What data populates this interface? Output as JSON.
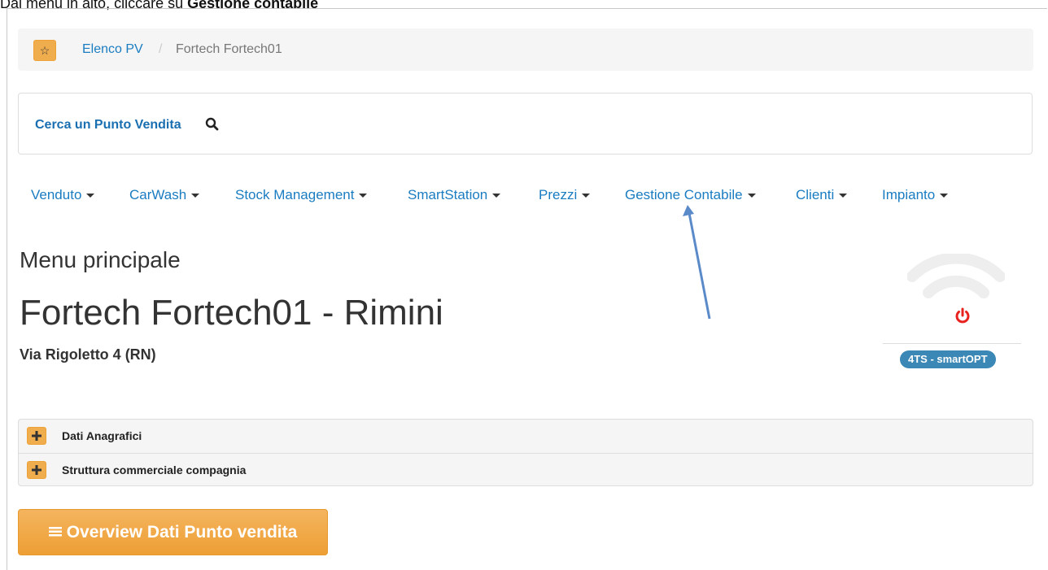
{
  "caption": {
    "prefix": "Dal menu in alto, cliccare su ",
    "bold": "Gestione contabile"
  },
  "breadcrumb": {
    "star_icon": "star-icon",
    "link": "Elenco PV",
    "separator": "/",
    "current": "Fortech Fortech01"
  },
  "search": {
    "label": "Cerca un Punto Vendita",
    "icon": "search-icon"
  },
  "nav": {
    "items": [
      {
        "label": "Venduto"
      },
      {
        "label": "CarWash"
      },
      {
        "label": "Stock Management"
      },
      {
        "label": "SmartStation"
      },
      {
        "label": "Prezzi"
      },
      {
        "label": "Gestione Contabile"
      },
      {
        "label": "Clienti"
      },
      {
        "label": "Impianto"
      }
    ]
  },
  "header": {
    "menu_title": "Menu principale",
    "store_title": "Fortech Fortech01 - Rimini",
    "address": "Via Rigoletto 4 (RN)"
  },
  "status": {
    "wifi_icon": "wifi-icon",
    "power_icon": "power-icon",
    "badge": "4TS - smartOPT",
    "power_color": "#e8231f",
    "badge_color": "#3b87b5"
  },
  "accordion": {
    "items": [
      {
        "label": "Dati Anagrafici",
        "icon": "plus-icon"
      },
      {
        "label": "Struttura commerciale compagnia",
        "icon": "plus-icon"
      }
    ]
  },
  "overview_button": {
    "label": "Overview Dati Punto vendita",
    "icon": "list-icon"
  },
  "colors": {
    "accent": "#f0ad4e",
    "link": "#1a7cc1",
    "annotation_arrow": "#5b8ac9"
  }
}
